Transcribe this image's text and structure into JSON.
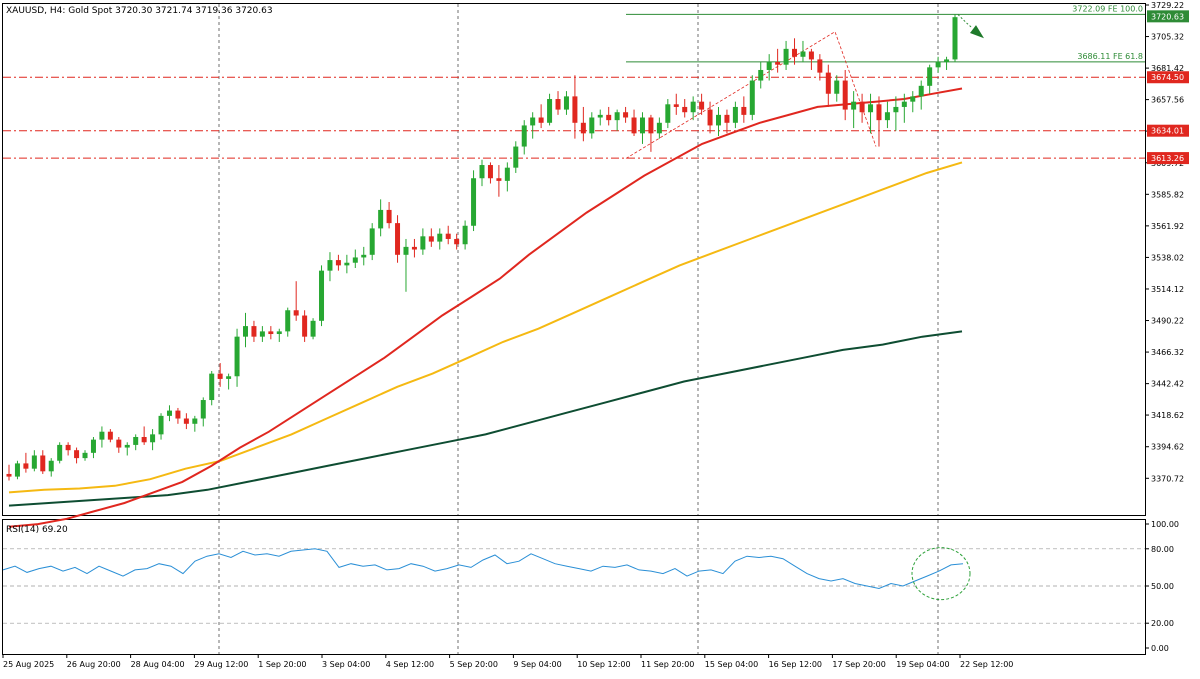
{
  "chart_data": {
    "type": "candlestick",
    "title": "XAUUSD, H4:  Gold Spot  3720.30 3721.74 3719.36 3720.63",
    "price_axis": {
      "min": 3346.7,
      "max": 3729.22,
      "ticks": [
        "3729.22",
        "3705.32",
        "3681.42",
        "3657.56",
        "3633.72",
        "3609.72",
        "3585.82",
        "3561.92",
        "3538.02",
        "3514.12",
        "3490.22",
        "3466.32",
        "3442.42",
        "3418.62",
        "3394.62",
        "3370.72"
      ]
    },
    "time_labels": [
      "25 Aug 2025",
      "26 Aug 20:00",
      "28 Aug 04:00",
      "29 Aug 12:00",
      "1 Sep 20:00",
      "3 Sep 04:00",
      "4 Sep 12:00",
      "5 Sep 20:00",
      "9 Sep 04:00",
      "10 Sep 12:00",
      "11 Sep 20:00",
      "15 Sep 04:00",
      "16 Sep 12:00",
      "17 Sep 20:00",
      "19 Sep 04:00",
      "22 Sep 12:00"
    ],
    "candles": [
      [
        3374,
        3381,
        3369,
        3372
      ],
      [
        3372,
        3384,
        3370,
        3382
      ],
      [
        3382,
        3390,
        3375,
        3378
      ],
      [
        3378,
        3392,
        3376,
        3388
      ],
      [
        3388,
        3392,
        3374,
        3376
      ],
      [
        3376,
        3386,
        3372,
        3384
      ],
      [
        3384,
        3398,
        3382,
        3396
      ],
      [
        3396,
        3398,
        3388,
        3392
      ],
      [
        3392,
        3394,
        3382,
        3386
      ],
      [
        3386,
        3392,
        3384,
        3390
      ],
      [
        3390,
        3402,
        3386,
        3400
      ],
      [
        3400,
        3410,
        3394,
        3406
      ],
      [
        3406,
        3408,
        3398,
        3400
      ],
      [
        3400,
        3402,
        3390,
        3394
      ],
      [
        3394,
        3398,
        3388,
        3396
      ],
      [
        3396,
        3404,
        3392,
        3402
      ],
      [
        3402,
        3410,
        3396,
        3398
      ],
      [
        3398,
        3408,
        3392,
        3404
      ],
      [
        3404,
        3420,
        3400,
        3418
      ],
      [
        3418,
        3426,
        3414,
        3422
      ],
      [
        3422,
        3424,
        3412,
        3416
      ],
      [
        3416,
        3420,
        3408,
        3412
      ],
      [
        3412,
        3418,
        3406,
        3416
      ],
      [
        3416,
        3432,
        3410,
        3430
      ],
      [
        3430,
        3452,
        3426,
        3450
      ],
      [
        3450,
        3458,
        3440,
        3446
      ],
      [
        3446,
        3450,
        3438,
        3448
      ],
      [
        3448,
        3484,
        3440,
        3478
      ],
      [
        3478,
        3496,
        3470,
        3486
      ],
      [
        3486,
        3490,
        3474,
        3478
      ],
      [
        3478,
        3486,
        3474,
        3482
      ],
      [
        3482,
        3486,
        3476,
        3480
      ],
      [
        3480,
        3484,
        3474,
        3482
      ],
      [
        3482,
        3500,
        3478,
        3498
      ],
      [
        3498,
        3520,
        3490,
        3494
      ],
      [
        3494,
        3498,
        3474,
        3478
      ],
      [
        3478,
        3492,
        3476,
        3490
      ],
      [
        3490,
        3532,
        3486,
        3528
      ],
      [
        3528,
        3542,
        3520,
        3536
      ],
      [
        3536,
        3540,
        3528,
        3532
      ],
      [
        3532,
        3540,
        3526,
        3534
      ],
      [
        3534,
        3544,
        3530,
        3538
      ],
      [
        3538,
        3546,
        3532,
        3540
      ],
      [
        3540,
        3564,
        3536,
        3560
      ],
      [
        3560,
        3582,
        3554,
        3574
      ],
      [
        3574,
        3580,
        3560,
        3564
      ],
      [
        3564,
        3570,
        3534,
        3540
      ],
      [
        3540,
        3552,
        3512,
        3546
      ],
      [
        3546,
        3552,
        3538,
        3544
      ],
      [
        3544,
        3560,
        3540,
        3554
      ],
      [
        3554,
        3560,
        3546,
        3550
      ],
      [
        3550,
        3560,
        3544,
        3556
      ],
      [
        3556,
        3562,
        3548,
        3552
      ],
      [
        3552,
        3556,
        3544,
        3548
      ],
      [
        3548,
        3566,
        3544,
        3562
      ],
      [
        3562,
        3604,
        3558,
        3598
      ],
      [
        3598,
        3612,
        3592,
        3608
      ],
      [
        3608,
        3610,
        3594,
        3598
      ],
      [
        3598,
        3608,
        3584,
        3596
      ],
      [
        3596,
        3610,
        3588,
        3606
      ],
      [
        3606,
        3626,
        3602,
        3622
      ],
      [
        3622,
        3642,
        3616,
        3638
      ],
      [
        3638,
        3648,
        3628,
        3644
      ],
      [
        3644,
        3654,
        3636,
        3640
      ],
      [
        3640,
        3662,
        3638,
        3658
      ],
      [
        3658,
        3664,
        3646,
        3650
      ],
      [
        3650,
        3664,
        3646,
        3660
      ],
      [
        3660,
        3676,
        3628,
        3640
      ],
      [
        3640,
        3652,
        3626,
        3632
      ],
      [
        3632,
        3648,
        3628,
        3644
      ],
      [
        3644,
        3650,
        3638,
        3646
      ],
      [
        3646,
        3652,
        3638,
        3642
      ],
      [
        3642,
        3650,
        3634,
        3648
      ],
      [
        3648,
        3652,
        3640,
        3644
      ],
      [
        3644,
        3650,
        3630,
        3632
      ],
      [
        3632,
        3648,
        3624,
        3644
      ],
      [
        3644,
        3646,
        3618,
        3632
      ],
      [
        3632,
        3644,
        3628,
        3640
      ],
      [
        3640,
        3658,
        3636,
        3654
      ],
      [
        3654,
        3662,
        3646,
        3652
      ],
      [
        3652,
        3658,
        3644,
        3648
      ],
      [
        3648,
        3660,
        3642,
        3656
      ],
      [
        3656,
        3662,
        3646,
        3650
      ],
      [
        3650,
        3656,
        3632,
        3638
      ],
      [
        3638,
        3652,
        3630,
        3646
      ],
      [
        3646,
        3650,
        3632,
        3640
      ],
      [
        3640,
        3656,
        3636,
        3652
      ],
      [
        3652,
        3660,
        3640,
        3646
      ],
      [
        3646,
        3676,
        3642,
        3672
      ],
      [
        3672,
        3686,
        3666,
        3680
      ],
      [
        3680,
        3692,
        3672,
        3686
      ],
      [
        3686,
        3696,
        3678,
        3684
      ],
      [
        3684,
        3702,
        3680,
        3696
      ],
      [
        3696,
        3704,
        3684,
        3690
      ],
      [
        3690,
        3702,
        3686,
        3694
      ],
      [
        3694,
        3696,
        3680,
        3688
      ],
      [
        3688,
        3692,
        3672,
        3678
      ],
      [
        3678,
        3684,
        3652,
        3662
      ],
      [
        3662,
        3676,
        3656,
        3672
      ],
      [
        3672,
        3680,
        3642,
        3650
      ],
      [
        3650,
        3664,
        3636,
        3656
      ],
      [
        3656,
        3662,
        3640,
        3648
      ],
      [
        3648,
        3662,
        3632,
        3654
      ],
      [
        3654,
        3660,
        3622,
        3642
      ],
      [
        3642,
        3656,
        3636,
        3648
      ],
      [
        3648,
        3660,
        3634,
        3652
      ],
      [
        3652,
        3662,
        3640,
        3656
      ],
      [
        3656,
        3664,
        3648,
        3660
      ],
      [
        3660,
        3672,
        3650,
        3668
      ],
      [
        3668,
        3684,
        3662,
        3682
      ],
      [
        3682,
        3690,
        3678,
        3686
      ],
      [
        3686,
        3690,
        3680,
        3688
      ],
      [
        3688,
        3722,
        3686,
        3720
      ]
    ],
    "ma_red": [
      3334,
      3336,
      3340,
      3346,
      3352,
      3360,
      3368,
      3380,
      3394,
      3406,
      3420,
      3434,
      3448,
      3462,
      3478,
      3494,
      3508,
      3522,
      3540,
      3556,
      3572,
      3586,
      3600,
      3612,
      3624,
      3632,
      3640,
      3646,
      3652,
      3654,
      3656,
      3658,
      3662,
      3666
    ],
    "ma_orange": [
      3360,
      3362,
      3363,
      3365,
      3370,
      3378,
      3384,
      3394,
      3404,
      3416,
      3428,
      3440,
      3450,
      3462,
      3474,
      3484,
      3496,
      3508,
      3520,
      3532,
      3542,
      3552,
      3562,
      3572,
      3582,
      3592,
      3602,
      3610
    ],
    "ma_green": [
      3350,
      3352,
      3354,
      3356,
      3358,
      3362,
      3368,
      3374,
      3380,
      3386,
      3392,
      3398,
      3404,
      3412,
      3420,
      3428,
      3436,
      3444,
      3450,
      3456,
      3462,
      3468,
      3472,
      3478,
      3482
    ],
    "rsi": [
      63,
      66,
      61,
      64,
      66,
      62,
      65,
      60,
      66,
      62,
      58,
      63,
      64,
      68,
      66,
      60,
      70,
      74,
      76,
      73,
      78,
      75,
      76,
      74,
      78,
      79,
      80,
      78,
      65,
      68,
      66,
      67,
      63,
      64,
      68,
      66,
      62,
      64,
      67,
      65,
      71,
      75,
      68,
      70,
      76,
      72,
      68,
      66,
      64,
      62,
      66,
      65,
      67,
      63,
      62,
      60,
      64,
      58,
      62,
      63,
      60,
      70,
      74,
      73,
      74,
      72,
      66,
      60,
      56,
      54,
      56,
      52,
      50,
      48,
      52,
      50,
      54,
      58,
      62,
      67,
      68
    ],
    "indicator_label": "RSI(14) 69.20",
    "rsi_ticks": [
      "100.00",
      "80.00",
      "50.00",
      "20.00",
      "0.00"
    ],
    "levels": [
      {
        "label": "3674.50",
        "value": 3674.5,
        "color": "#e0271f"
      },
      {
        "label": "3634.01",
        "value": 3634.01,
        "color": "#e0271f"
      },
      {
        "label": "3613.26",
        "value": 3613.26,
        "color": "#e0271f"
      }
    ],
    "fib_lines": [
      {
        "text": "3722.09 FE 100.0",
        "value": 3722.09
      },
      {
        "text": "3686.11 FE 61.8",
        "value": 3686.11
      }
    ],
    "current_price": "3720.63",
    "colors": {
      "up": "#27a732",
      "down": "#e0271f",
      "ma_red": "#e0271f",
      "ma_orange": "#f5b912",
      "ma_green": "#0e4d32",
      "rsi": "#2a8fd6",
      "fib": "#2e8b36"
    }
  }
}
